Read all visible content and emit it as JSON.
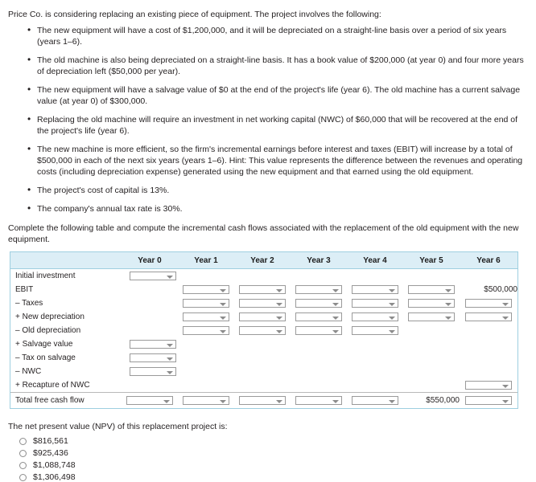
{
  "intro": "Price Co. is considering replacing an existing piece of equipment. The project involves the following:",
  "bullets": [
    "The new equipment will have a cost of $1,200,000, and it will be depreciated on a straight-line basis over a period of six years (years 1–6).",
    "The old machine is also being depreciated on a straight-line basis. It has a book value of $200,000 (at year 0) and four more years of depreciation left ($50,000 per year).",
    "The new equipment will have a salvage value of $0 at the end of the project's life (year 6). The old machine has a current salvage value (at year 0) of $300,000.",
    "Replacing the old machine will require an investment in net working capital (NWC) of $60,000 that will be recovered at the end of the project's life (year 6).",
    "The new machine is more efficient, so the firm's incremental earnings before interest and taxes (EBIT) will increase by a total of $500,000 in each of the next six years (years 1–6). Hint: This value represents the difference between the revenues and operating costs (including depreciation expense) generated using the new equipment and that earned using the old equipment.",
    "The project's cost of capital is 13%.",
    "The company's annual tax rate is 30%."
  ],
  "instruction": "Complete the following table and compute the incremental cash flows associated with the replacement of the old equipment with the new equipment.",
  "table": {
    "columns": [
      "",
      "Year 0",
      "Year 1",
      "Year 2",
      "Year 3",
      "Year 4",
      "Year 5",
      "Year 6"
    ],
    "rows": [
      {
        "label": "Initial investment",
        "cells": [
          {
            "type": "dropdown",
            "align": "left"
          },
          {
            "type": "empty"
          },
          {
            "type": "empty"
          },
          {
            "type": "empty"
          },
          {
            "type": "empty"
          },
          {
            "type": "empty"
          },
          {
            "type": "empty"
          }
        ]
      },
      {
        "label": "EBIT",
        "cells": [
          {
            "type": "empty"
          },
          {
            "type": "dropdown"
          },
          {
            "type": "dropdown"
          },
          {
            "type": "dropdown"
          },
          {
            "type": "dropdown"
          },
          {
            "type": "dropdown"
          },
          {
            "type": "value",
            "value": "$500,000"
          }
        ]
      },
      {
        "label": "– Taxes",
        "cells": [
          {
            "type": "empty"
          },
          {
            "type": "dropdown"
          },
          {
            "type": "dropdown"
          },
          {
            "type": "dropdown"
          },
          {
            "type": "dropdown"
          },
          {
            "type": "dropdown"
          },
          {
            "type": "dropdown"
          }
        ]
      },
      {
        "label": "+ New depreciation",
        "cells": [
          {
            "type": "empty"
          },
          {
            "type": "dropdown"
          },
          {
            "type": "dropdown"
          },
          {
            "type": "dropdown"
          },
          {
            "type": "dropdown"
          },
          {
            "type": "dropdown"
          },
          {
            "type": "dropdown"
          }
        ]
      },
      {
        "label": "– Old depreciation",
        "cells": [
          {
            "type": "empty"
          },
          {
            "type": "dropdown"
          },
          {
            "type": "dropdown"
          },
          {
            "type": "dropdown"
          },
          {
            "type": "dropdown"
          },
          {
            "type": "empty"
          },
          {
            "type": "empty"
          }
        ]
      },
      {
        "label": "+ Salvage value",
        "cells": [
          {
            "type": "dropdown",
            "align": "left"
          },
          {
            "type": "empty"
          },
          {
            "type": "empty"
          },
          {
            "type": "empty"
          },
          {
            "type": "empty"
          },
          {
            "type": "empty"
          },
          {
            "type": "empty"
          }
        ]
      },
      {
        "label": "– Tax on salvage",
        "cells": [
          {
            "type": "dropdown",
            "align": "left"
          },
          {
            "type": "empty"
          },
          {
            "type": "empty"
          },
          {
            "type": "empty"
          },
          {
            "type": "empty"
          },
          {
            "type": "empty"
          },
          {
            "type": "empty"
          }
        ]
      },
      {
        "label": "– NWC",
        "cells": [
          {
            "type": "dropdown",
            "align": "left"
          },
          {
            "type": "empty"
          },
          {
            "type": "empty"
          },
          {
            "type": "empty"
          },
          {
            "type": "empty"
          },
          {
            "type": "empty"
          },
          {
            "type": "empty"
          }
        ]
      },
      {
        "label": "+ Recapture of NWC",
        "cells": [
          {
            "type": "empty"
          },
          {
            "type": "empty"
          },
          {
            "type": "empty"
          },
          {
            "type": "empty"
          },
          {
            "type": "empty"
          },
          {
            "type": "empty"
          },
          {
            "type": "dropdown"
          }
        ]
      },
      {
        "label": "Total free cash flow",
        "total": true,
        "cells": [
          {
            "type": "dropdown"
          },
          {
            "type": "dropdown"
          },
          {
            "type": "dropdown"
          },
          {
            "type": "dropdown"
          },
          {
            "type": "dropdown"
          },
          {
            "type": "value",
            "value": "$550,000"
          },
          {
            "type": "dropdown"
          }
        ]
      }
    ]
  },
  "npv": {
    "question": "The net present value (NPV) of this replacement project is:",
    "options": [
      "$816,561",
      "$925,436",
      "$1,088,748",
      "$1,306,498"
    ]
  }
}
